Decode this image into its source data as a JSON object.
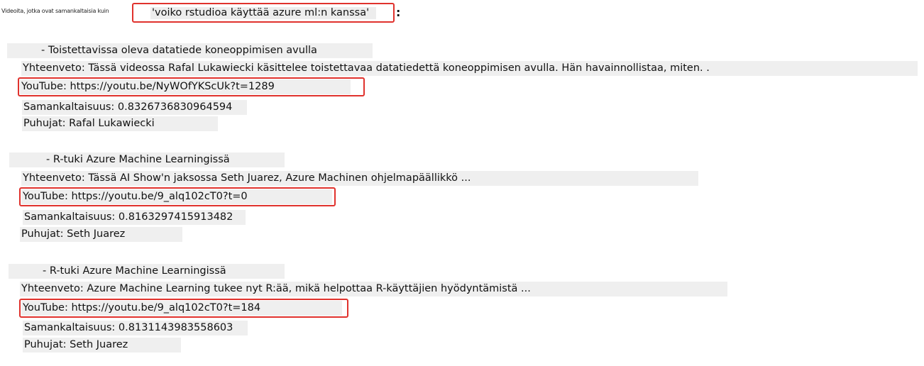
{
  "query": {
    "label": "Videoita, jotka ovat samankaltaisia kuin",
    "text": "'voiko rstudioa käyttää azure ml:n kanssa'",
    "colon": ":"
  },
  "results": [
    {
      "title": "- Toistettavissa oleva datatiede koneoppimisen avulla",
      "summary": "Yhteenveto: Tässä videossa Rafal Lukawiecki käsittelee toistettavaa datatiedettä koneoppimisen avulla. Hän havainnollistaa, miten. .",
      "youtube": "YouTube: https://youtu.be/NyWOfYKScUk?t=1289",
      "similarity": "Samankaltaisuus: 0.8326736830964594",
      "speakers": "Puhujat: Rafal Lukawiecki"
    },
    {
      "title": "- R-tuki Azure Machine Learningissä",
      "summary": "Yhteenveto: Tässä AI Show'n jaksossa Seth Juarez, Azure Machinen ohjelmapäällikkö ...",
      "youtube": "YouTube: https://youtu.be/9_alq102cT0?t=0",
      "similarity": "Samankaltaisuus: 0.8163297415913482",
      "speakers": "Puhujat: Seth Juarez"
    },
    {
      "title": "- R-tuki Azure Machine Learningissä",
      "summary": "Yhteenveto: Azure Machine Learning tukee nyt R:ää, mikä helpottaa R-käyttäjien hyödyntämistä ...",
      "youtube": "YouTube: https://youtu.be/9_alq102cT0?t=184",
      "similarity": "Samankaltaisuus: 0.8131143983558603",
      "speakers": "Puhujat: Seth Juarez"
    }
  ],
  "colors": {
    "highlight_border": "#e0322d",
    "row_background": "#efefef"
  }
}
